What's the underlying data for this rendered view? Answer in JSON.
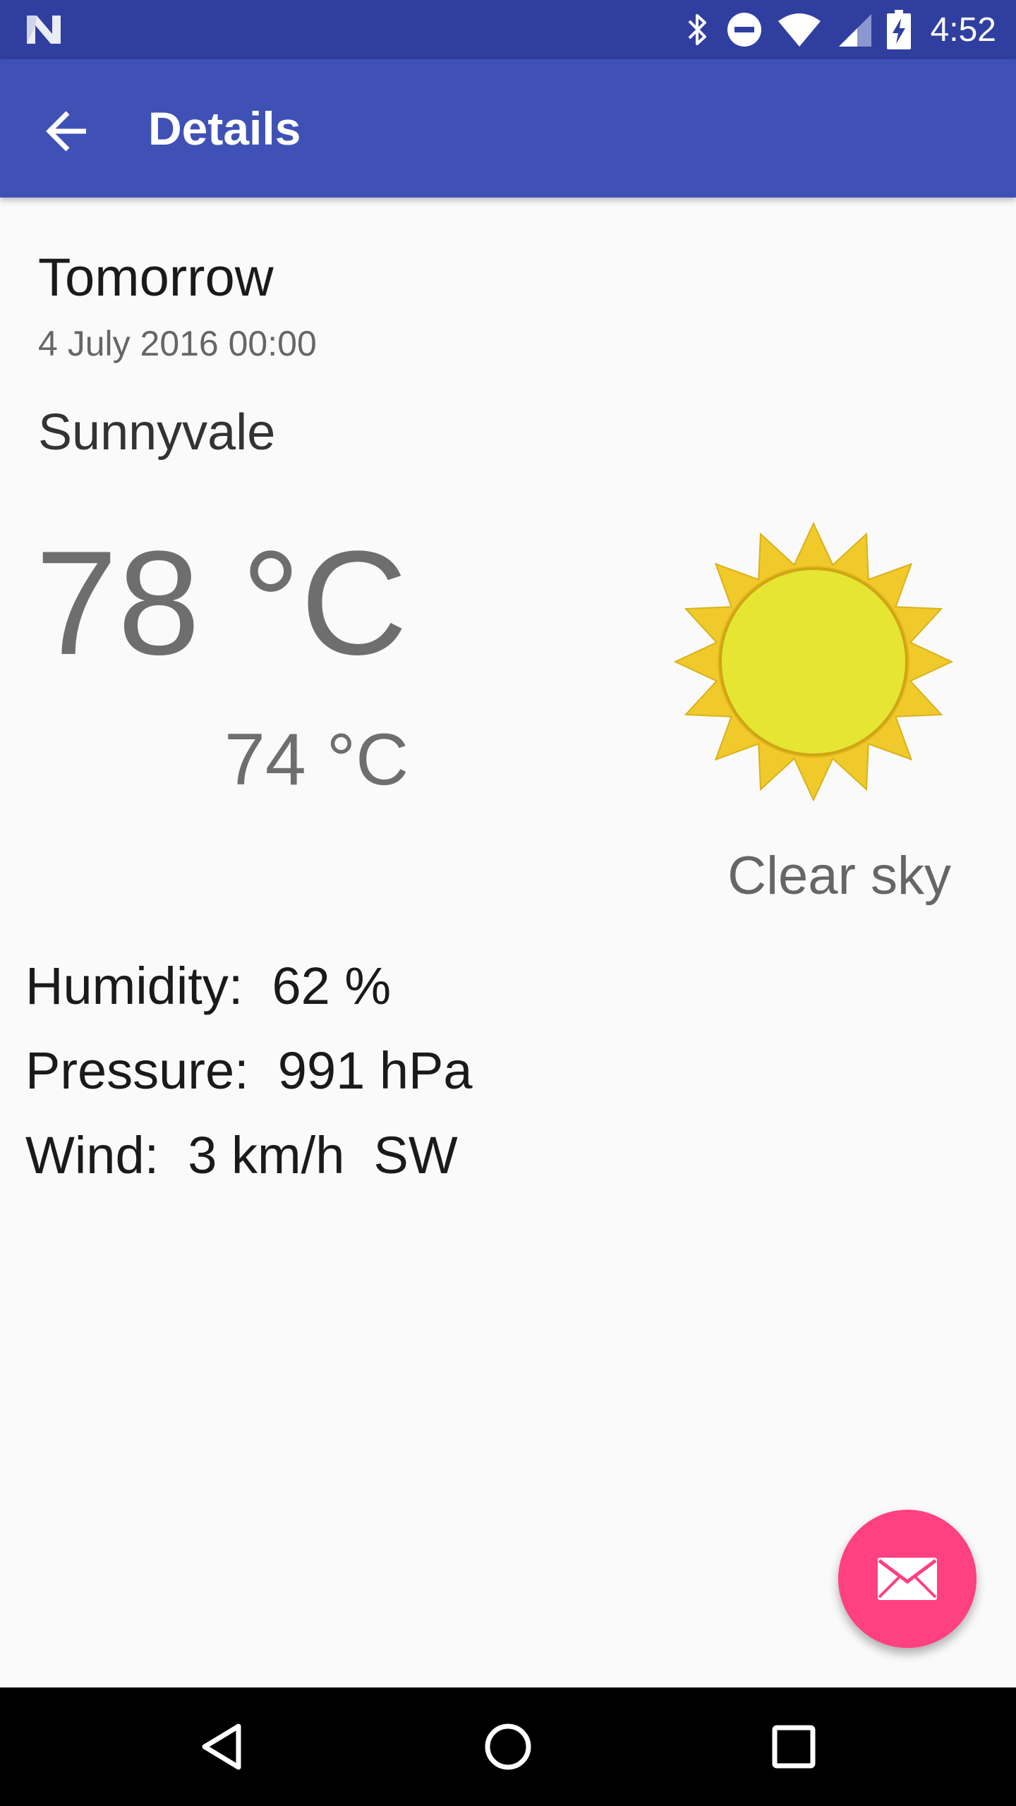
{
  "status_bar": {
    "time": "4:52",
    "icons": [
      "n-logo-icon",
      "bluetooth-icon",
      "do-not-disturb-icon",
      "wifi-icon",
      "cell-signal-icon",
      "battery-charging-icon"
    ]
  },
  "app_bar": {
    "title": "Details",
    "back_icon": "arrow-back-icon",
    "color": "#3f51b5",
    "status_color": "#303f9f"
  },
  "forecast": {
    "day": "Tomorrow",
    "date": "4 July 2016 00:00",
    "city": "Sunnyvale",
    "high_temp": "78 °C",
    "low_temp": "74 °C",
    "condition": "Clear sky",
    "condition_icon": "sun-icon"
  },
  "details": {
    "humidity": "Humidity:  62 %",
    "pressure": "Pressure:  991 hPa",
    "wind": "Wind:  3 km/h  SW"
  },
  "fab": {
    "icon": "email-icon",
    "color": "#ff4081"
  },
  "nav_bar": {
    "icons": [
      "back-triangle-icon",
      "home-circle-icon",
      "recents-square-icon"
    ]
  }
}
